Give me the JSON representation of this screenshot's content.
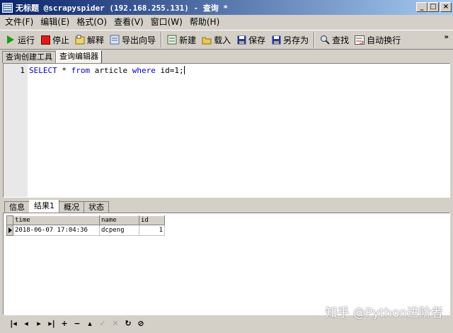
{
  "window": {
    "title": "无标题 @scrapyspider (192.168.255.131) - 查询 *"
  },
  "menu": [
    "文件(F)",
    "编辑(E)",
    "格式(O)",
    "查看(V)",
    "窗口(W)",
    "帮助(H)"
  ],
  "toolbar": {
    "run": "运行",
    "stop": "停止",
    "explain": "解释",
    "export": "导出向导",
    "new": "新建",
    "load": "载入",
    "save": "保存",
    "save_as": "另存为",
    "find": "查找",
    "wrap": "自动换行"
  },
  "editor_tabs": [
    "查询创建工具",
    "查询编辑器"
  ],
  "editor": {
    "line_number": "1",
    "sql": {
      "kw1": "SELECT",
      "t1": " * ",
      "kw2": "from",
      "t2": " article ",
      "kw3": "where",
      "t3": " id=1;"
    }
  },
  "result_tabs": [
    "信息",
    "结果1",
    "概况",
    "状态"
  ],
  "results": {
    "columns": [
      "time",
      "name",
      "id"
    ],
    "rows": [
      [
        "2018-06-07 17:04:36",
        "dcpeng",
        "1"
      ]
    ]
  },
  "watermark": "知乎 @Python进阶者",
  "colors": {
    "title_start": "#0a246a",
    "title_end": "#a6caf0",
    "keyword": "#0000cc",
    "chrome": "#d4d0c8"
  }
}
